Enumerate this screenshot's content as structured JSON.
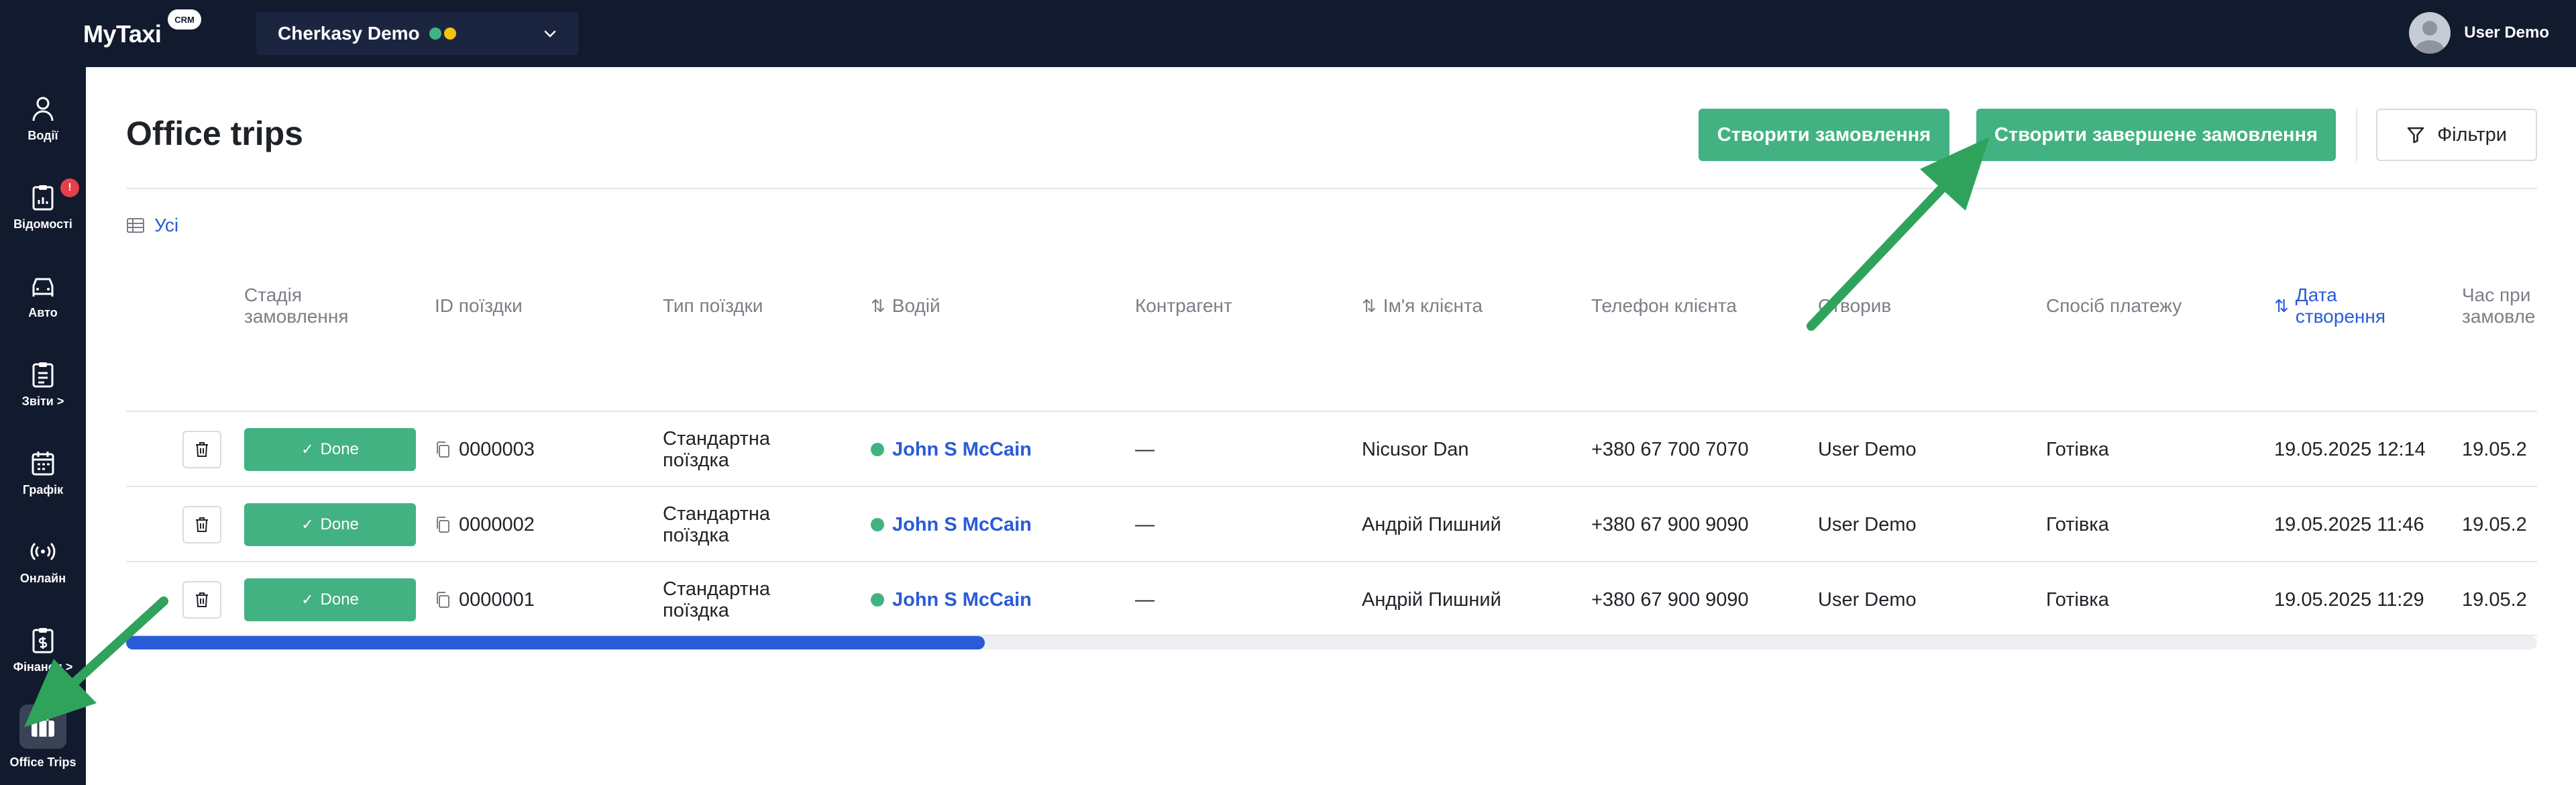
{
  "app": {
    "logo": "MyTaxi",
    "logo_badge": "CRM",
    "company": "Cherkasy Demo",
    "user_name": "User Demo"
  },
  "colors": {
    "topbar": "#121a2e",
    "accent_green": "#43b283",
    "link_blue": "#2a5bd7",
    "alert_red": "#e5404b"
  },
  "sidebar": {
    "items": [
      {
        "label": "Водії",
        "icon": "person-icon"
      },
      {
        "label": "Відомості",
        "icon": "clipboard-chart-icon",
        "badge": "!"
      },
      {
        "label": "Авто",
        "icon": "car-icon"
      },
      {
        "label": "Звіти >",
        "icon": "report-icon"
      },
      {
        "label": "Графік",
        "icon": "calendar-icon"
      },
      {
        "label": "Онлайн",
        "icon": "broadcast-icon"
      },
      {
        "label": "Фінанси >",
        "icon": "finance-icon"
      },
      {
        "label": "Office Trips",
        "icon": "briefcase-icon",
        "active": true
      }
    ]
  },
  "page": {
    "title": "Office trips",
    "create_order": "Створити замовлення",
    "create_completed_order": "Створити завершене замовлення",
    "filters": "Фільтри",
    "view_tab": "Усі"
  },
  "table": {
    "headers": {
      "stage": "Стадія замовлення",
      "trip_id": "ID поїздки",
      "trip_type": "Тип поїздки",
      "driver": "Водій",
      "contractor": "Контрагент",
      "client_name": "Ім'я клієнта",
      "client_phone": "Телефон клієнта",
      "created_by": "Створив",
      "payment": "Спосіб платежу",
      "created_date": "Дата створення",
      "order_time": "Час при замовле"
    },
    "rows": [
      {
        "stage": "Done",
        "trip_id": "0000003",
        "trip_type": "Стандартна поїздка",
        "driver": "John S McCain",
        "contractor": "—",
        "client_name": "Nicusor Dan",
        "client_phone": "+380 67 700 7070",
        "created_by": "User Demo",
        "payment": "Готівка",
        "created_date": "19.05.2025 12:14",
        "order_time": "19.05.2"
      },
      {
        "stage": "Done",
        "trip_id": "0000002",
        "trip_type": "Стандартна поїздка",
        "driver": "John S McCain",
        "contractor": "—",
        "client_name": "Андрій Пишний",
        "client_phone": "+380 67 900 9090",
        "created_by": "User Demo",
        "payment": "Готівка",
        "created_date": "19.05.2025 11:46",
        "order_time": "19.05.2"
      },
      {
        "stage": "Done",
        "trip_id": "0000001",
        "trip_type": "Стандартна поїздка",
        "driver": "John S McCain",
        "contractor": "—",
        "client_name": "Андрій Пишний",
        "client_phone": "+380 67 900 9090",
        "created_by": "User Demo",
        "payment": "Готівка",
        "created_date": "19.05.2025 11:29",
        "order_time": "19.05.2"
      }
    ]
  },
  "scroll": {
    "horizontal_position_fraction": 0.36
  }
}
